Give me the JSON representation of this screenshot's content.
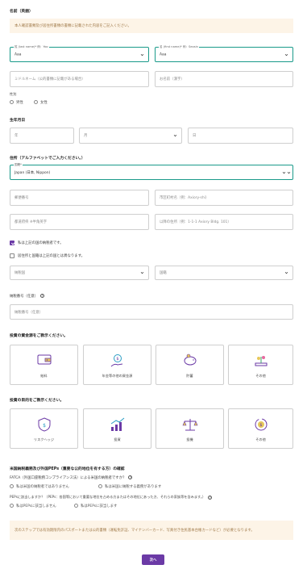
{
  "name_section": {
    "heading": "名前（英語）",
    "notice": "本人確認書類及び居住所書類の書類に記載された内容をご記入ください。",
    "last_name": {
      "label": "姓 (last name)* 例：Yoo",
      "value": "Aaa"
    },
    "first_name": {
      "label": "名 (first name)* 例：Seosin",
      "value": "Aaa"
    },
    "middle_name_placeholder": "ミドルネーム（公的書類に記載がある場合）",
    "kanji_name_placeholder": "お名前（漢字）",
    "gender_label": "性別",
    "gender_options": [
      "男性",
      "女性"
    ]
  },
  "birth_section": {
    "heading": "生年月日",
    "year": "年",
    "month": "月",
    "day": "日"
  },
  "address_section": {
    "heading": "住所（アルファベットでご入力ください。）",
    "country": {
      "label": "国籍*",
      "value": "Japan (日本, Nippon)"
    },
    "postal_placeholder": "郵便番号",
    "city_placeholder": "市区町村名（例：Axiory-shi）",
    "prefecture_placeholder": "都道府県 ※半角英字",
    "street_placeholder": "以降の住所（例：1-1-1 Axiory Bldg. 101）",
    "tax_resident_checkbox": "私は上記の国の納税者です。",
    "other_country_checkbox": "居住所と国籍は上記の国とは異なります。",
    "select_country": "納税国",
    "select_nationality": "国籍",
    "tax_id_label": "納税番号（任意）",
    "tax_id_placeholder": "納税番号（任意）"
  },
  "funds_section": {
    "heading": "投資の資金源をご教示ください。",
    "options": [
      "給料",
      "年金等の他の資金源",
      "貯蓄",
      "その他"
    ]
  },
  "purpose_section": {
    "heading": "投資の目的をご教示ください。",
    "options": [
      "リスクヘッジ",
      "投資",
      "投機",
      "その他"
    ]
  },
  "fatca_section": {
    "heading": "米国納税義務及び外国PEPs（重要な公的地位を有する方）の確認",
    "fatca_question": "FATCA（外国口座税務コンプライアンス法）による米国の納税者ですか？",
    "fatca_options": [
      "私は米国の納税者ではありません",
      "私は米国に納税する義務があります"
    ],
    "peps_question": "PEPsに該当しますか？（PEPs：各国等において重要な地位を占める方またはその地位にあった方、それらの家族等を含みます。）",
    "peps_options": [
      "私はPEPsに該当しません",
      "私はPEPsに該当します"
    ]
  },
  "footer_notice": "次のステップでは有効期限内のパスポートまたは公的書類（運転免許証、マイナンバーカード、写真付き住民基本台帳カードなど）が必要となります。",
  "submit_label": "次へ",
  "colors": {
    "accent": "#6b3aa6",
    "teal_border": "#1a9a8a",
    "notice_bg": "#fdf4e7"
  }
}
